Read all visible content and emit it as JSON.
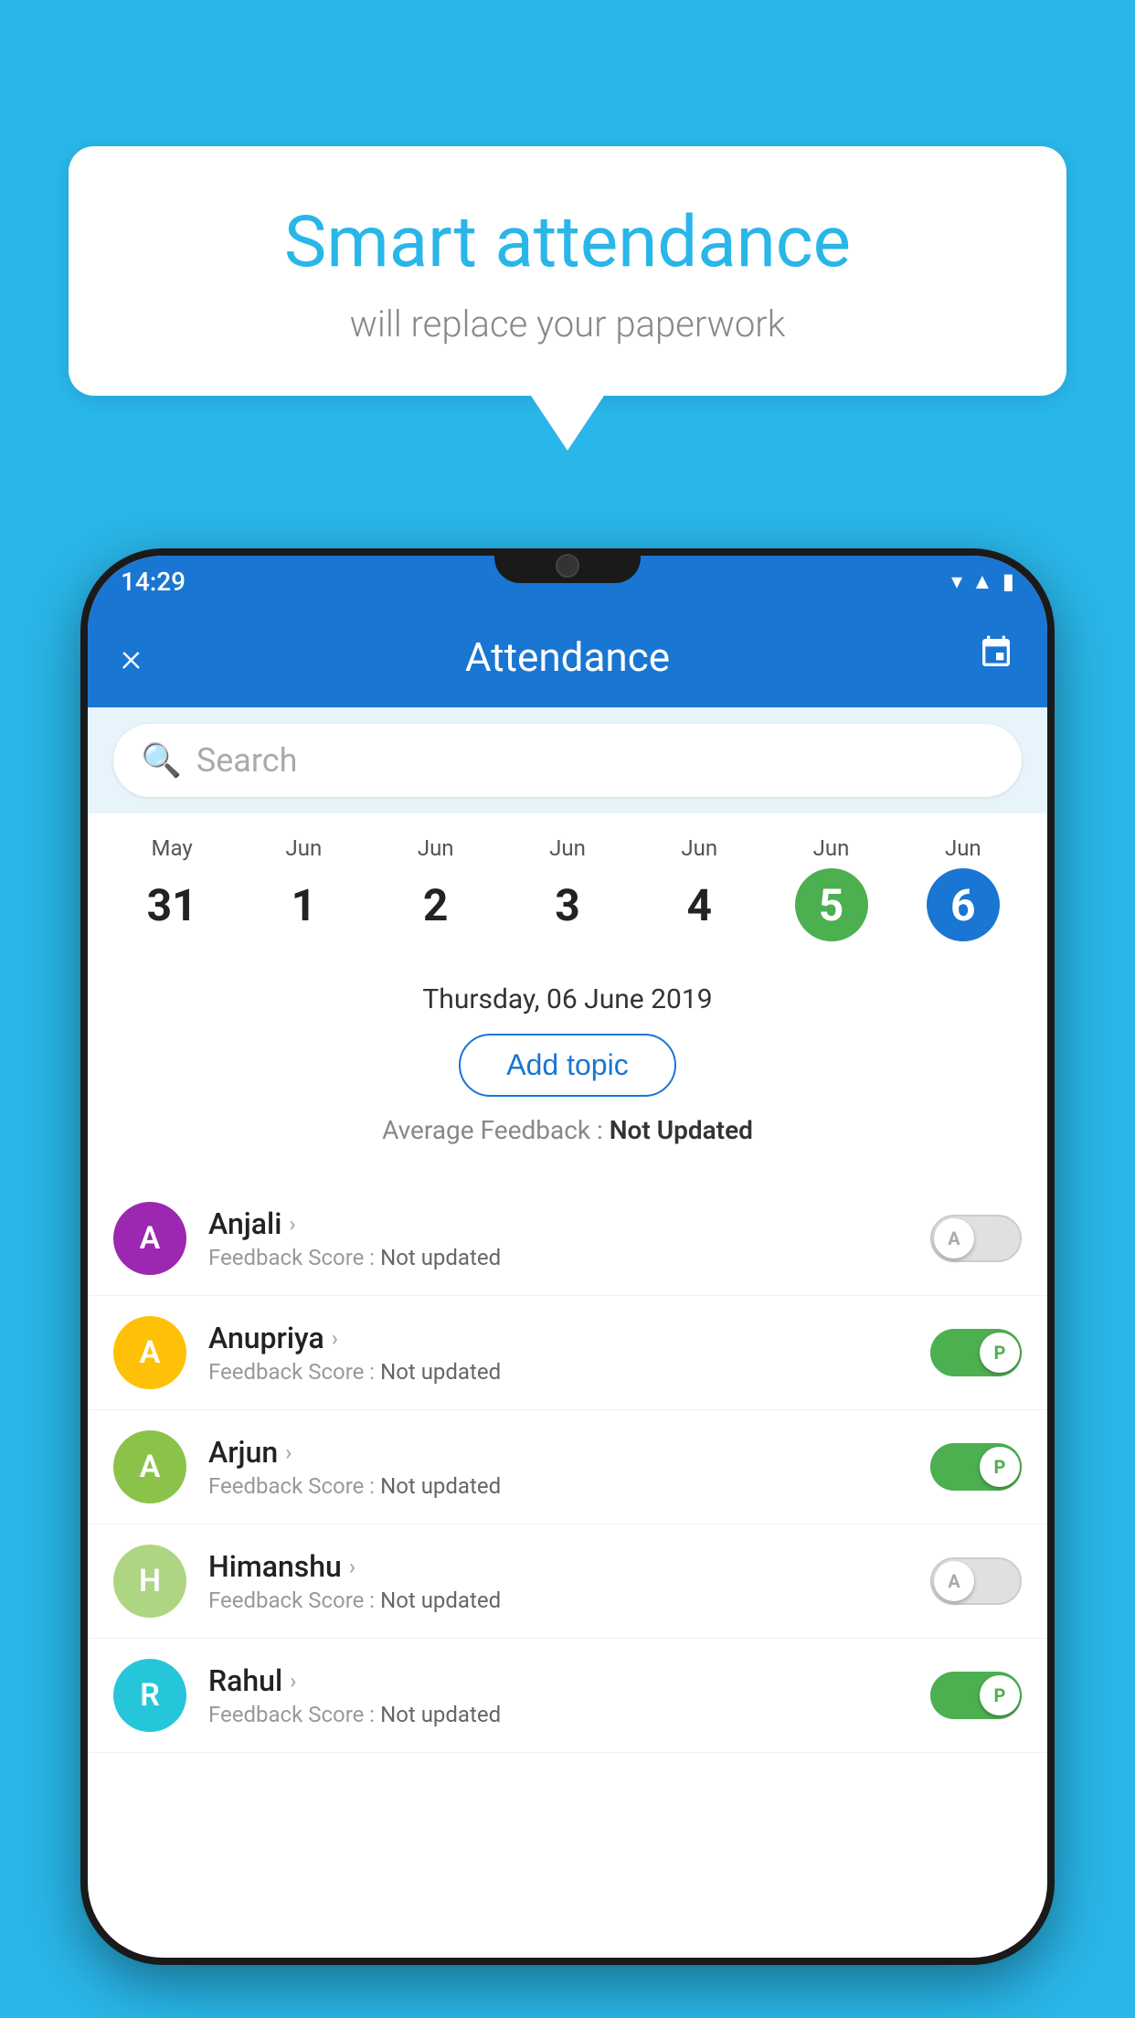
{
  "background_color": "#29b6e8",
  "speech_bubble": {
    "title": "Smart attendance",
    "subtitle": "will replace your paperwork"
  },
  "status_bar": {
    "time": "14:29",
    "icons": [
      "wifi",
      "signal",
      "battery"
    ]
  },
  "app_bar": {
    "title": "Attendance",
    "close_label": "×",
    "calendar_label": "📅"
  },
  "search": {
    "placeholder": "Search"
  },
  "calendar": {
    "days": [
      {
        "month": "May",
        "date": "31",
        "style": "normal"
      },
      {
        "month": "Jun",
        "date": "1",
        "style": "normal"
      },
      {
        "month": "Jun",
        "date": "2",
        "style": "normal"
      },
      {
        "month": "Jun",
        "date": "3",
        "style": "normal"
      },
      {
        "month": "Jun",
        "date": "4",
        "style": "normal"
      },
      {
        "month": "Jun",
        "date": "5",
        "style": "green"
      },
      {
        "month": "Jun",
        "date": "6",
        "style": "blue"
      }
    ]
  },
  "selected_date": "Thursday, 06 June 2019",
  "add_topic_label": "Add topic",
  "average_feedback": {
    "label": "Average Feedback : ",
    "value": "Not Updated"
  },
  "students": [
    {
      "name": "Anjali",
      "avatar_letter": "A",
      "avatar_color": "#9c27b0",
      "feedback_label": "Feedback Score : ",
      "feedback_value": "Not updated",
      "toggle_state": "off",
      "toggle_letter": "A"
    },
    {
      "name": "Anupriya",
      "avatar_letter": "A",
      "avatar_color": "#ffc107",
      "feedback_label": "Feedback Score : ",
      "feedback_value": "Not updated",
      "toggle_state": "on",
      "toggle_letter": "P"
    },
    {
      "name": "Arjun",
      "avatar_letter": "A",
      "avatar_color": "#8bc34a",
      "feedback_label": "Feedback Score : ",
      "feedback_value": "Not updated",
      "toggle_state": "on",
      "toggle_letter": "P"
    },
    {
      "name": "Himanshu",
      "avatar_letter": "H",
      "avatar_color": "#aed581",
      "feedback_label": "Feedback Score : ",
      "feedback_value": "Not updated",
      "toggle_state": "off",
      "toggle_letter": "A"
    },
    {
      "name": "Rahul",
      "avatar_letter": "R",
      "avatar_color": "#26c6da",
      "feedback_label": "Feedback Score : ",
      "feedback_value": "Not updated",
      "toggle_state": "on",
      "toggle_letter": "P"
    }
  ]
}
